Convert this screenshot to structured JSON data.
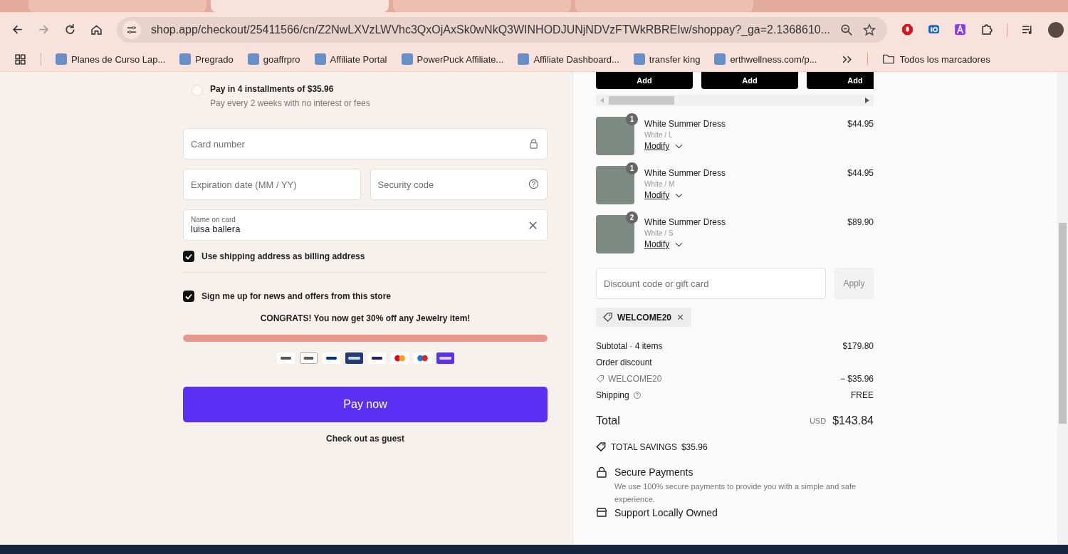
{
  "browser": {
    "tabs": [
      {
        "selected": false
      },
      {
        "selected": true
      },
      {
        "selected": false
      },
      {
        "selected": false
      }
    ],
    "url": "shop.app/checkout/25411566/cn/Z2NwLXVzLWVhc3QxOjAxSk0wNkQ3WINHODJUNjNDVzFTWkRBREIw/shoppay?_ga=2.1368610...",
    "bookmarks": [
      {
        "label": "Planes de Curso Lap..."
      },
      {
        "label": "Pregrado"
      },
      {
        "label": "goaffrpro"
      },
      {
        "label": "Affiliate Portal"
      },
      {
        "label": "PowerPuck Affiliate..."
      },
      {
        "label": "Affiliate Dashboard..."
      },
      {
        "label": "transfer king"
      },
      {
        "label": "erthwellness.com/p..."
      }
    ],
    "all_bookmarks": "Todos los marcadores"
  },
  "payment": {
    "installments": {
      "title": "Pay in 4 installments of $35.96",
      "subtitle": "Pay every 2 weeks with no interest or fees",
      "selected": false
    },
    "card_number": {
      "placeholder": "Card number"
    },
    "expiration": {
      "placeholder": "Expiration date (MM / YY)"
    },
    "security_code": {
      "placeholder": "Security code"
    },
    "name_on_card": {
      "label": "Name on card",
      "value": "luisa ballera"
    },
    "checkboxes": [
      {
        "label": "Use shipping address as billing address",
        "checked": true
      },
      {
        "label": "Sign me up for news and offers from this store",
        "checked": true
      }
    ],
    "promo": "CONGRATS! You now get 30% off any Jewelry item!",
    "progress": {
      "level": 1
    },
    "pay_button": "Pay now",
    "guest_link": "Check out as guest"
  },
  "summary": {
    "add_buttons": [
      "Add",
      "Add",
      "Add"
    ],
    "items": [
      {
        "name": "White Summer Dress",
        "variant": "White / L",
        "price": "$44.95",
        "quantity": "1",
        "action": "Modify"
      },
      {
        "name": "White Summer Dress",
        "variant": "White / M",
        "price": "$44.95",
        "quantity": "1",
        "action": "Modify"
      },
      {
        "name": "White Summer Dress",
        "variant": "White / S",
        "price": "$89.90",
        "quantity": "2",
        "action": "Modify"
      }
    ],
    "discount": {
      "placeholder": "Discount code or gift card",
      "button": "Apply"
    },
    "applied_code": "WELCOME20",
    "subtotal": {
      "label": "Subtotal · 4 items",
      "value": "$179.80"
    },
    "order_discount": {
      "label": "Order discount",
      "code": "WELCOME20",
      "value": "− $35.96"
    },
    "shipping": {
      "label": "Shipping",
      "value": "FREE"
    },
    "total": {
      "label": "Total",
      "currency": "USD",
      "value": "$143.84"
    },
    "savings": {
      "label": "TOTAL SAVINGS",
      "value": "$35.96"
    },
    "secure": {
      "title": "Secure Payments",
      "text": "We use 100% secure payments to provide you with a simple and safe experience."
    },
    "support": "Support Locally Owned"
  }
}
